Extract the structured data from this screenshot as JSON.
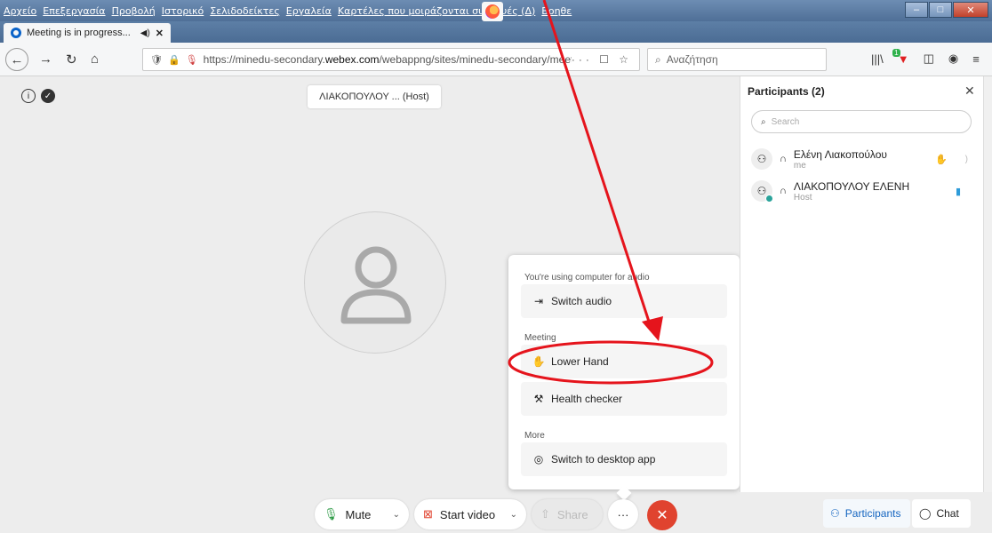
{
  "menubar": {
    "items": [
      "Αρχείο",
      "Επεξεργασία",
      "Προβολή",
      "Ιστορικό",
      "Σελιδοδείκτες",
      "Εργαλεία",
      "Καρτέλες που μοιράζονται συσκευές (Δ)",
      "Βοηθε"
    ]
  },
  "tabs": [
    {
      "title": "Meeting is in progress...",
      "audio": "◀)",
      "close": "✕"
    }
  ],
  "newtab": "+",
  "navbar": {
    "url_prefix": "https://minedu-secondary.",
    "url_host": "webex.com",
    "url_suffix": "/webappng/sites/minedu-secondary/meeting",
    "url_actions": "··· ☐ ☆",
    "search_placeholder": "Αναζήτηση"
  },
  "meeting": {
    "host_label": "ΛΙΑΚΟΠΟΥΛΟΥ ... (Host)"
  },
  "popup": {
    "audio_section": "You're using computer for audio",
    "switch_audio": "Switch audio",
    "meeting_section": "Meeting",
    "lower_hand": "Lower Hand",
    "health_checker": "Health checker",
    "more_section": "More",
    "switch_desktop": "Switch to desktop app"
  },
  "controls": {
    "mute": "Mute",
    "start_video": "Start video",
    "share": "Share",
    "more": "···",
    "leave": "✕"
  },
  "panel": {
    "title": "Participants (2)",
    "search_placeholder": "Search",
    "participants": [
      {
        "name": "Ελένη Λιακοπούλου",
        "sub": "me"
      },
      {
        "name": "ΛΙΑΚΟΠΟΥΛΟΥ ΕΛΕΝΗ",
        "sub": "Host"
      }
    ],
    "participants_button": "Participants",
    "chat_button": "Chat"
  },
  "colors": {
    "leave": "#e0432f",
    "accent": "#1565c0",
    "annotation": "#e5141c"
  }
}
